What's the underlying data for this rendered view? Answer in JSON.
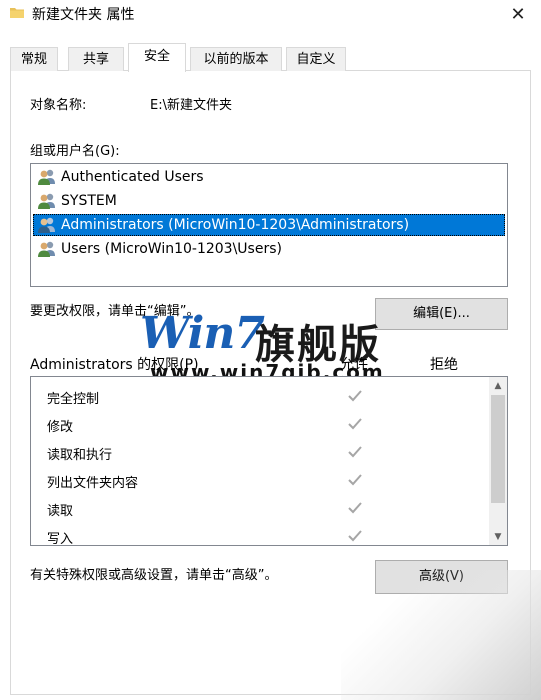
{
  "window": {
    "title": "新建文件夹 属性",
    "close_glyph": "✕"
  },
  "tabs": [
    {
      "label": "常规"
    },
    {
      "label": "共享"
    },
    {
      "label": "安全"
    },
    {
      "label": "以前的版本"
    },
    {
      "label": "自定义"
    }
  ],
  "active_tab": "安全",
  "object": {
    "label": "对象名称:",
    "value": "E:\\新建文件夹"
  },
  "groups": {
    "label": "组或用户名(G):",
    "items": [
      {
        "name": "Authenticated Users",
        "icon": "users-icon"
      },
      {
        "name": "SYSTEM",
        "icon": "users-icon"
      },
      {
        "name": "Administrators (MicroWin10-1203\\Administrators)",
        "icon": "users-icon",
        "selected": true
      },
      {
        "name": "Users (MicroWin10-1203\\Users)",
        "icon": "users-icon"
      }
    ]
  },
  "edit": {
    "hint": "要更改权限，请单击“编辑”。",
    "button_label": "编辑(E)..."
  },
  "permissions": {
    "title": "Administrators 的权限(P)",
    "allow_header": "允许",
    "deny_header": "拒绝",
    "rows": [
      {
        "name": "完全控制",
        "allow": true,
        "deny": false
      },
      {
        "name": "修改",
        "allow": true,
        "deny": false
      },
      {
        "name": "读取和执行",
        "allow": true,
        "deny": false
      },
      {
        "name": "列出文件夹内容",
        "allow": true,
        "deny": false
      },
      {
        "name": "读取",
        "allow": true,
        "deny": false
      },
      {
        "name": "写入",
        "allow": true,
        "deny": false
      }
    ]
  },
  "advanced": {
    "hint": "有关特殊权限或高级设置，请单击“高级”。",
    "button_label": "高级(V)"
  },
  "watermark": {
    "logo": "Win7",
    "cn": "旗舰版",
    "url": "www.win7qjb.com"
  },
  "colors": {
    "selection": "#0078d7",
    "check": "#a6a6a6",
    "logo": "#1a5fb4"
  }
}
